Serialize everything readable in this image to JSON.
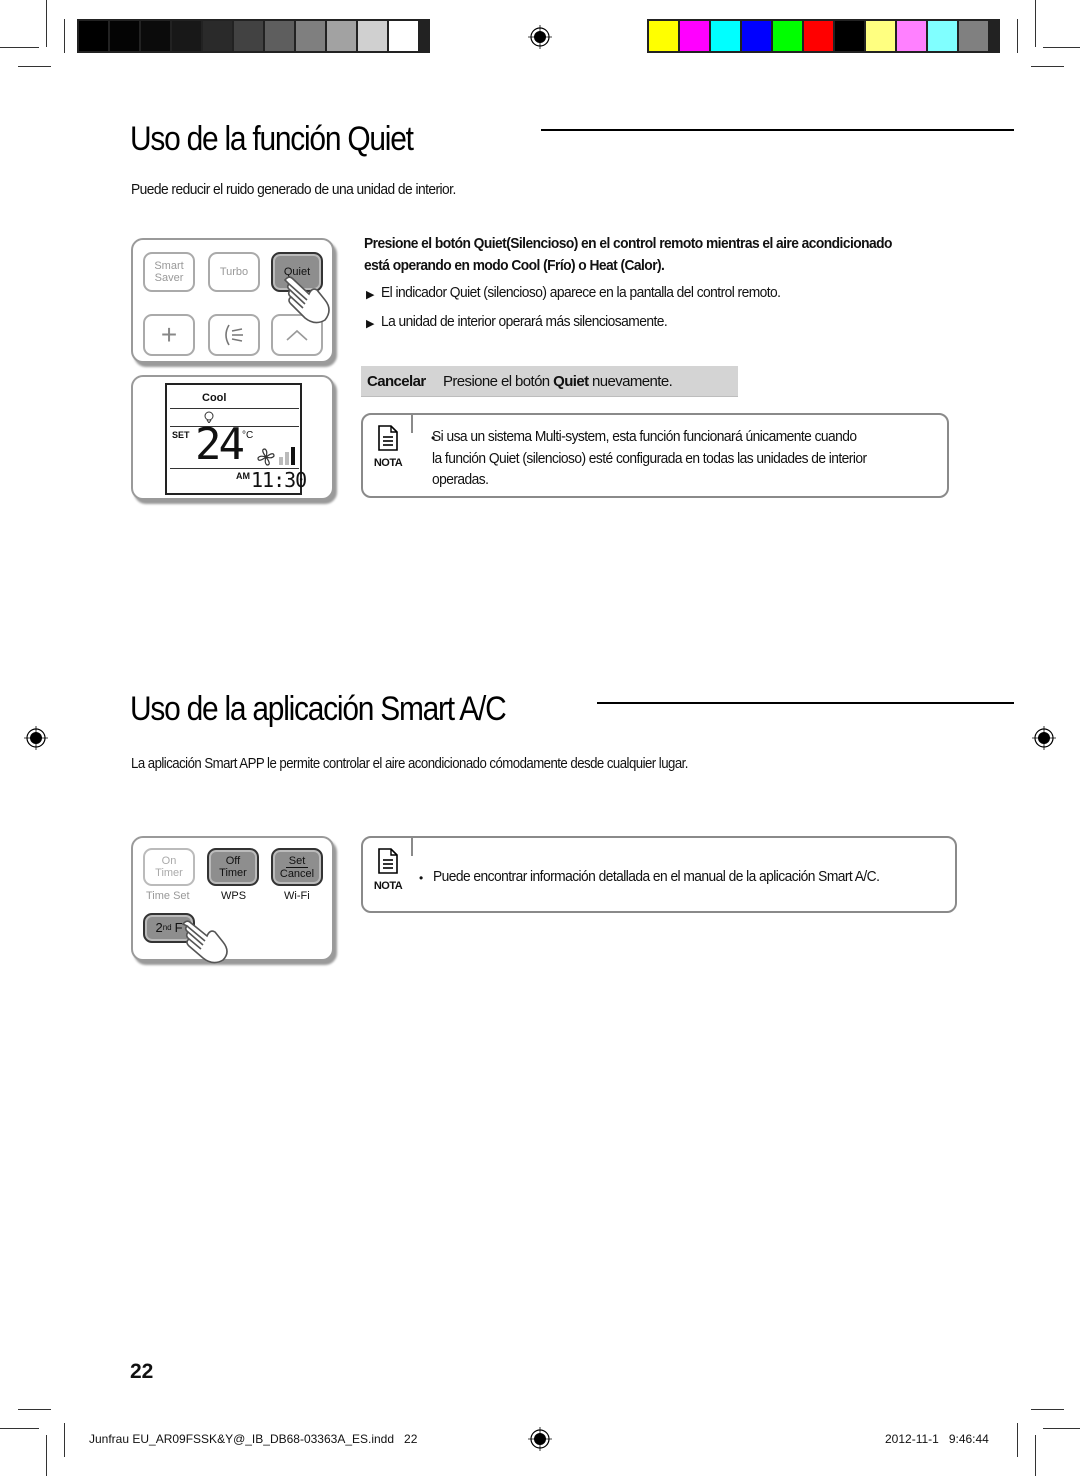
{
  "color_bars": {
    "grayscale": [
      "#000000",
      "#040404",
      "#0b0b0b",
      "#181818",
      "#2a2a2a",
      "#424242",
      "#5e5e5e",
      "#7f7f7f",
      "#a2a2a2",
      "#d0d0d0",
      "#ffffff"
    ],
    "process": [
      "#ffff00",
      "#ff00ff",
      "#00ffff",
      "#0000ff",
      "#00ff00",
      "#ff0000",
      "#000000",
      "#ffff80",
      "#ff80ff",
      "#80ffff",
      "#808080"
    ]
  },
  "section_quiet": {
    "title": "Uso de la función Quiet",
    "intro": "Puede reducir el ruido generado de una unidad de interior.",
    "instruction_line1": "Presione el botón Quiet(Silencioso) en el control remoto mientras el aire acondicionado",
    "instruction_line2": "está operando en modo Cool (Frío) o Heat (Calor).",
    "bullets": [
      "El indicador Quiet (silencioso) aparece en la pantalla del control remoto.",
      "La unidad de interior operará más silenciosamente."
    ],
    "cancel": {
      "label": "Cancelar",
      "text_before": "Presione el botón ",
      "text_bold": "Quiet",
      "text_after": " nuevamente."
    },
    "note": {
      "label": "NOTA",
      "line1": "Si usa un sistema Multi-system, esta función funcionará únicamente cuando",
      "line2": "la función Quiet (silencioso) esté configurada en todas las unidades de interior",
      "line3": "operadas."
    },
    "remote_buttons": {
      "smart_saver_1": "Smart",
      "smart_saver_2": "Saver",
      "turbo": "Turbo",
      "quiet": "Quiet",
      "plus": "+",
      "up": "^"
    },
    "display": {
      "mode": "Cool",
      "set_label": "SET",
      "temperature": "24",
      "unit": "°C",
      "am_label": "AM",
      "time": "11:30"
    }
  },
  "section_smart": {
    "title": "Uso de la aplicación Smart A/C",
    "intro": "La aplicación Smart APP le permite controlar el aire acondicionado cómodamente desde cualquier lugar.",
    "note": {
      "label": "NOTA",
      "text": "Puede encontrar información detallada en el manual de la aplicación Smart A/C."
    },
    "remote_buttons": {
      "on_timer_1": "On",
      "on_timer_2": "Timer",
      "on_timer_sub": "Time Set",
      "off_timer_1": "Off",
      "off_timer_2": "Timer",
      "off_timer_sub": "WPS",
      "set_cancel_1": "Set",
      "set_cancel_2": "Cancel",
      "set_cancel_sub": "Wi-Fi",
      "second_f": "2",
      "second_f_sup": "nd",
      "second_f_f": "F"
    }
  },
  "page_number": "22",
  "footer": {
    "file": "Junfrau EU_AR09FSSK&Y@_IB_DB68-03363A_ES.indd   22",
    "timestamp": "2012-11-1   9:46:44"
  }
}
